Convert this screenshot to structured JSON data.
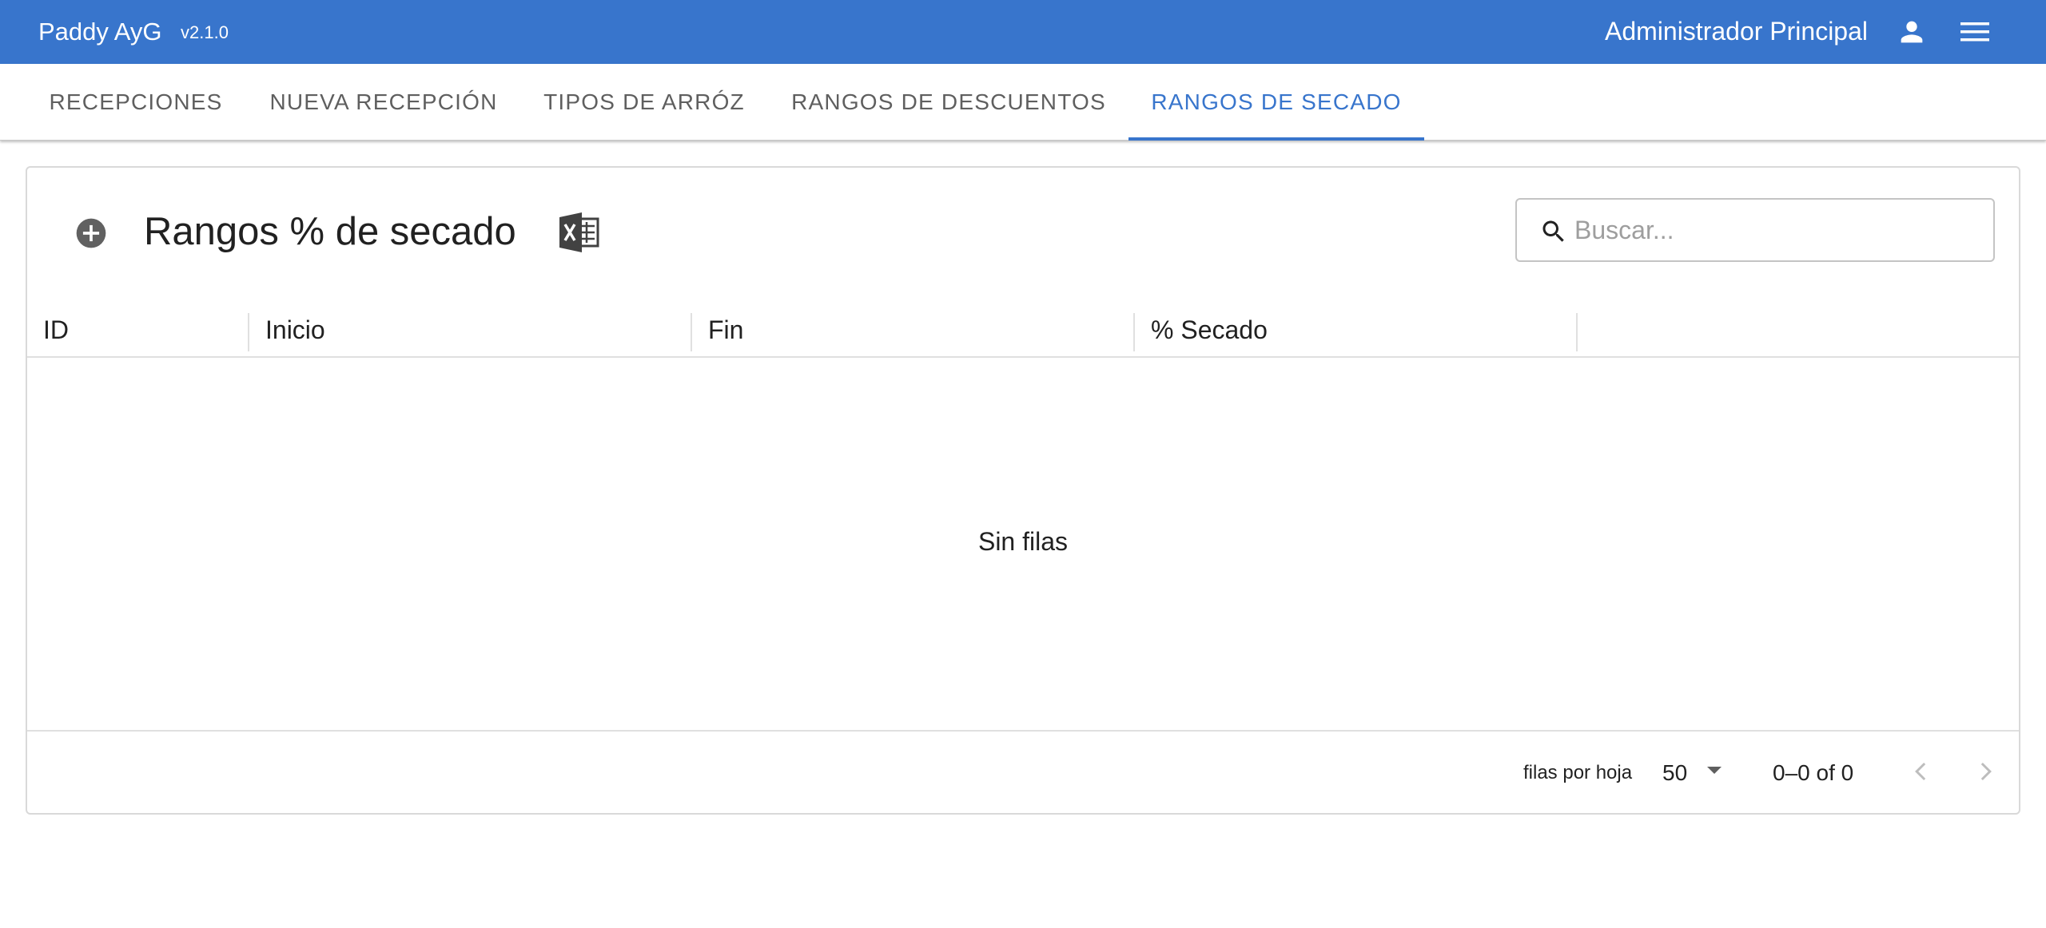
{
  "app": {
    "title": "Paddy AyG",
    "version": "v2.1.0",
    "user_name": "Administrador Principal",
    "accent_color": "#3875cc"
  },
  "tabs": [
    {
      "label": "RECEPCIONES",
      "active": false
    },
    {
      "label": "NUEVA RECEPCIÓN",
      "active": false
    },
    {
      "label": "TIPOS DE ARRÓZ",
      "active": false
    },
    {
      "label": "RANGOS DE DESCUENTOS",
      "active": false
    },
    {
      "label": "RANGOS DE SECADO",
      "active": true
    }
  ],
  "card": {
    "title": "Rangos % de secado",
    "add_icon": "add-circle-icon",
    "export_icon": "excel-icon"
  },
  "search": {
    "placeholder": "Buscar...",
    "value": ""
  },
  "grid": {
    "columns": [
      "ID",
      "Inicio",
      "Fin",
      "% Secado"
    ],
    "rows": [],
    "empty_message": "Sin filas"
  },
  "pagination": {
    "rows_per_page_label": "filas por hoja",
    "rows_per_page": "50",
    "range_text": "0–0 of 0"
  }
}
